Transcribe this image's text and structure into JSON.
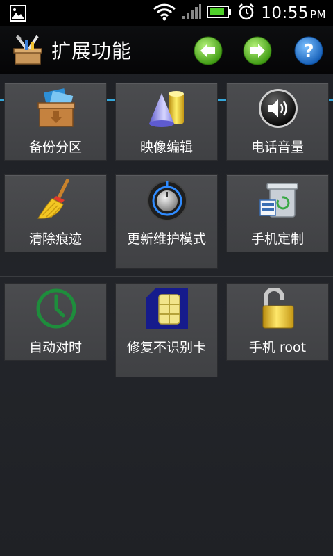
{
  "status_bar": {
    "time": "10:55",
    "ampm": "PM"
  },
  "header": {
    "title": "扩展功能"
  },
  "colors": {
    "accent": "#35a7da",
    "nav_green": "#5dbb2a",
    "help_blue": "#1f74c9"
  },
  "tiles": [
    {
      "label": "备份分区",
      "icon": "backup-box-icon"
    },
    {
      "label": "映像编辑",
      "icon": "image-shapes-icon"
    },
    {
      "label": "电话音量",
      "icon": "speaker-volume-icon"
    },
    {
      "label": "清除痕迹",
      "icon": "broom-icon"
    },
    {
      "label": "更新维护模式",
      "icon": "dial-knob-icon"
    },
    {
      "label": "手机定制",
      "icon": "trash-recycle-icon"
    },
    {
      "label": "自动对时",
      "icon": "clock-icon"
    },
    {
      "label": "修复不识别卡",
      "icon": "sim-card-icon"
    },
    {
      "label": "手机 root",
      "icon": "unlock-padlock-icon"
    }
  ]
}
